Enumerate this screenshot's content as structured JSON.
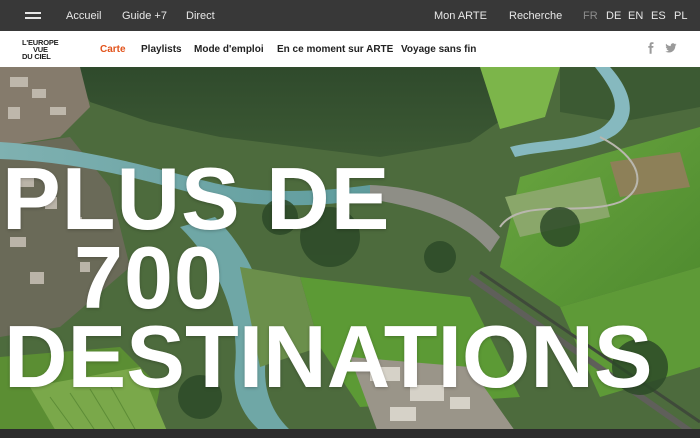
{
  "topbar": {
    "nav": [
      "Accueil",
      "Guide +7",
      "Direct",
      "Mon ARTE",
      "Recherche"
    ],
    "languages": [
      "FR",
      "DE",
      "EN",
      "ES",
      "PL"
    ],
    "active_language": "FR"
  },
  "header": {
    "logo_lines": [
      "L'EUROPE",
      "VUE",
      "DU CIEL"
    ],
    "nav": [
      "Carte",
      "Playlists",
      "Mode d'emploi",
      "En ce moment sur ARTE",
      "Voyage sans fin"
    ],
    "active_nav": "Carte",
    "accent_color": "#e2531b",
    "social_icons": [
      "facebook-icon",
      "twitter-icon"
    ]
  },
  "hero": {
    "headline": [
      "PLUS DE",
      "700",
      "DESTINATIONS"
    ]
  }
}
